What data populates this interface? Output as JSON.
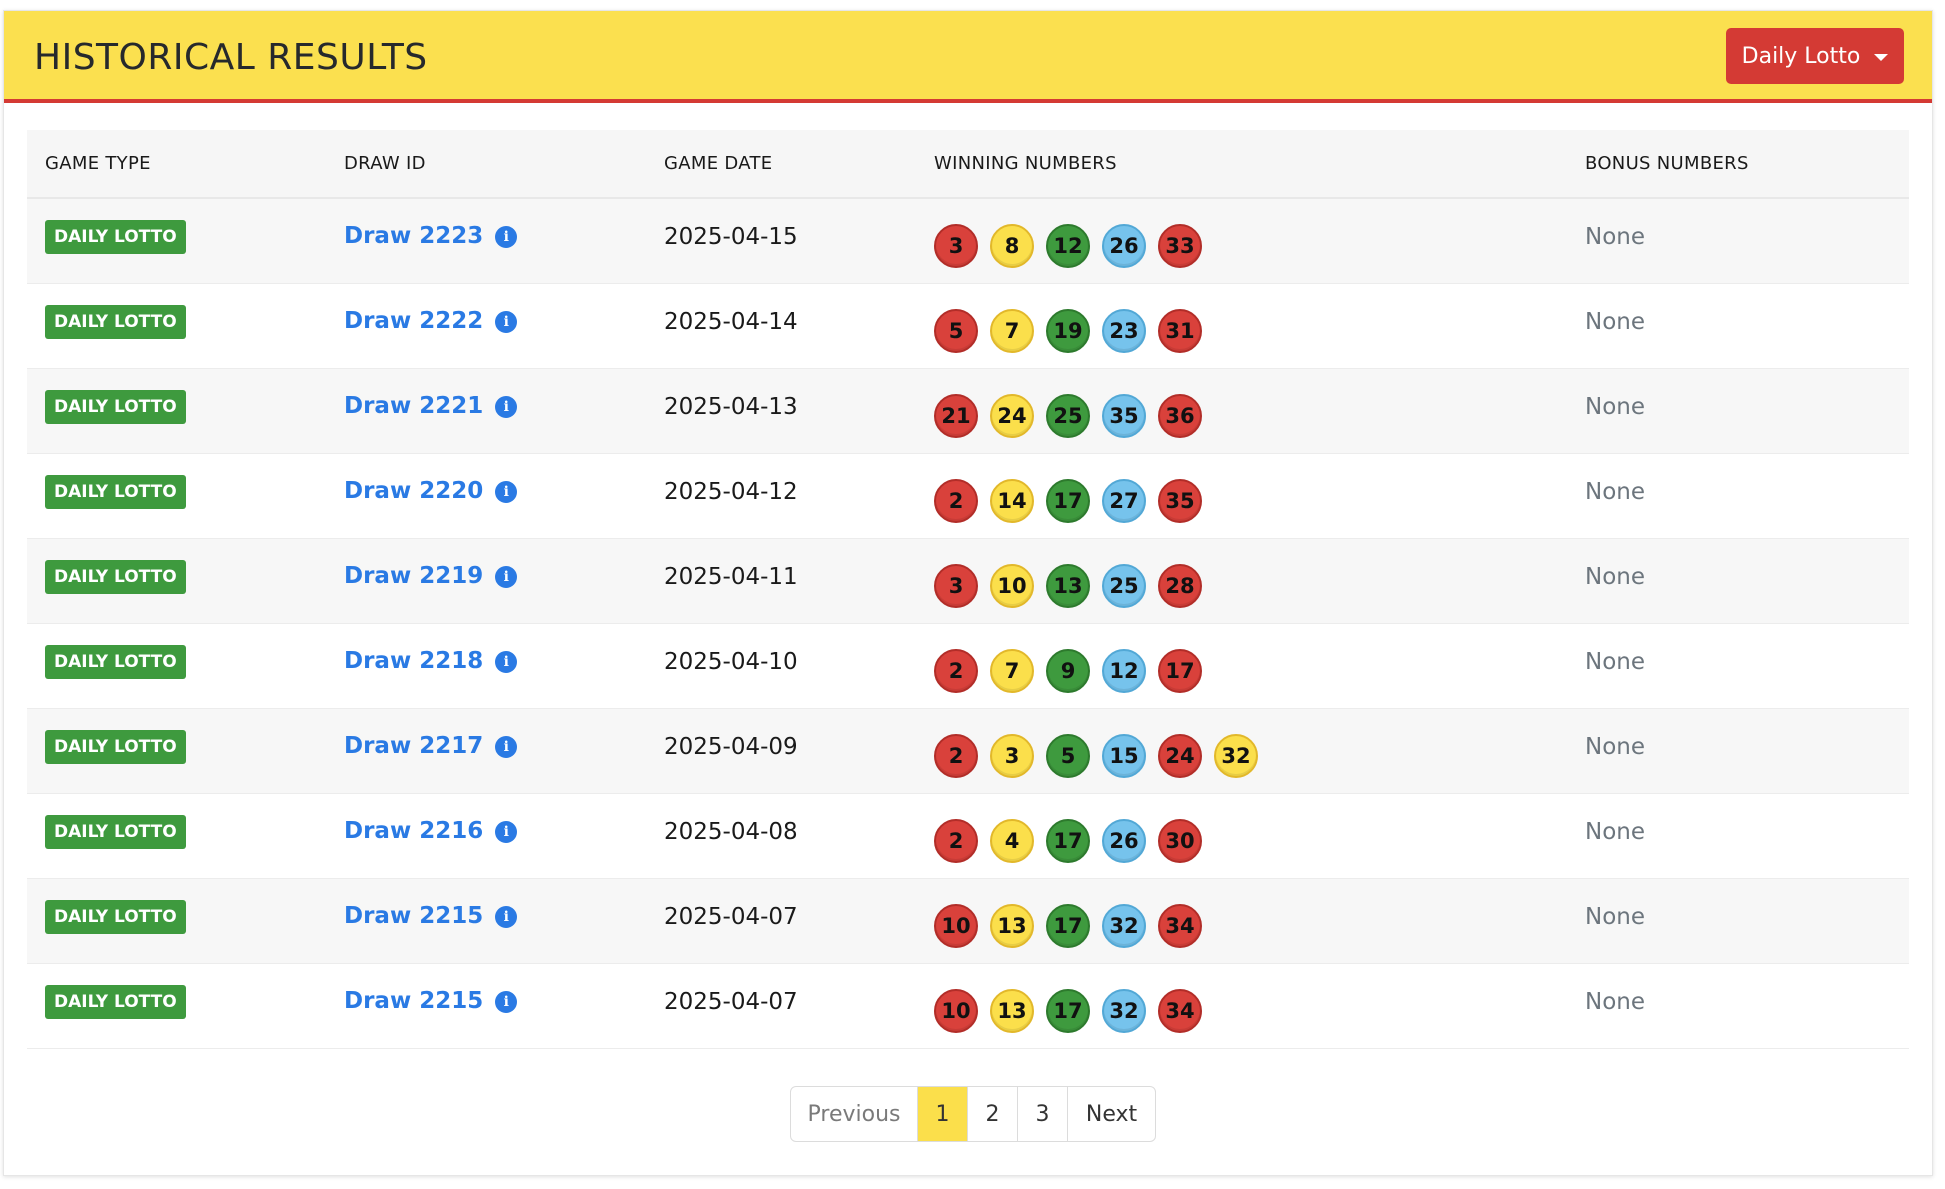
{
  "header": {
    "title": "HISTORICAL RESULTS",
    "game_select": "Daily Lotto"
  },
  "columns": [
    "GAME TYPE",
    "DRAW ID",
    "GAME DATE",
    "WINNING NUMBERS",
    "BONUS NUMBERS"
  ],
  "ball_colors": {
    "red": "#d9413b",
    "yellow": "#fbdf4b",
    "green": "#3e9a3e",
    "blue": "#76c3ec"
  },
  "rows": [
    {
      "game": "DAILY LOTTO",
      "draw": "Draw 2223",
      "date": "2025-04-15",
      "numbers": [
        3,
        8,
        12,
        26,
        33
      ],
      "bonus": "None"
    },
    {
      "game": "DAILY LOTTO",
      "draw": "Draw 2222",
      "date": "2025-04-14",
      "numbers": [
        5,
        7,
        19,
        23,
        31
      ],
      "bonus": "None"
    },
    {
      "game": "DAILY LOTTO",
      "draw": "Draw 2221",
      "date": "2025-04-13",
      "numbers": [
        21,
        24,
        25,
        35,
        36
      ],
      "bonus": "None"
    },
    {
      "game": "DAILY LOTTO",
      "draw": "Draw 2220",
      "date": "2025-04-12",
      "numbers": [
        2,
        14,
        17,
        27,
        35
      ],
      "bonus": "None"
    },
    {
      "game": "DAILY LOTTO",
      "draw": "Draw 2219",
      "date": "2025-04-11",
      "numbers": [
        3,
        10,
        13,
        25,
        28
      ],
      "bonus": "None"
    },
    {
      "game": "DAILY LOTTO",
      "draw": "Draw 2218",
      "date": "2025-04-10",
      "numbers": [
        2,
        7,
        9,
        12,
        17
      ],
      "bonus": "None"
    },
    {
      "game": "DAILY LOTTO",
      "draw": "Draw 2217",
      "date": "2025-04-09",
      "numbers": [
        2,
        3,
        5,
        15,
        24,
        32
      ],
      "bonus": "None"
    },
    {
      "game": "DAILY LOTTO",
      "draw": "Draw 2216",
      "date": "2025-04-08",
      "numbers": [
        2,
        4,
        17,
        26,
        30
      ],
      "bonus": "None"
    },
    {
      "game": "DAILY LOTTO",
      "draw": "Draw 2215",
      "date": "2025-04-07",
      "numbers": [
        10,
        13,
        17,
        32,
        34
      ],
      "bonus": "None"
    },
    {
      "game": "DAILY LOTTO",
      "draw": "Draw 2215",
      "date": "2025-04-07",
      "numbers": [
        10,
        13,
        17,
        32,
        34
      ],
      "bonus": "None"
    }
  ],
  "pagination": {
    "previous": "Previous",
    "pages": [
      "1",
      "2",
      "3"
    ],
    "active": "1",
    "next": "Next"
  }
}
